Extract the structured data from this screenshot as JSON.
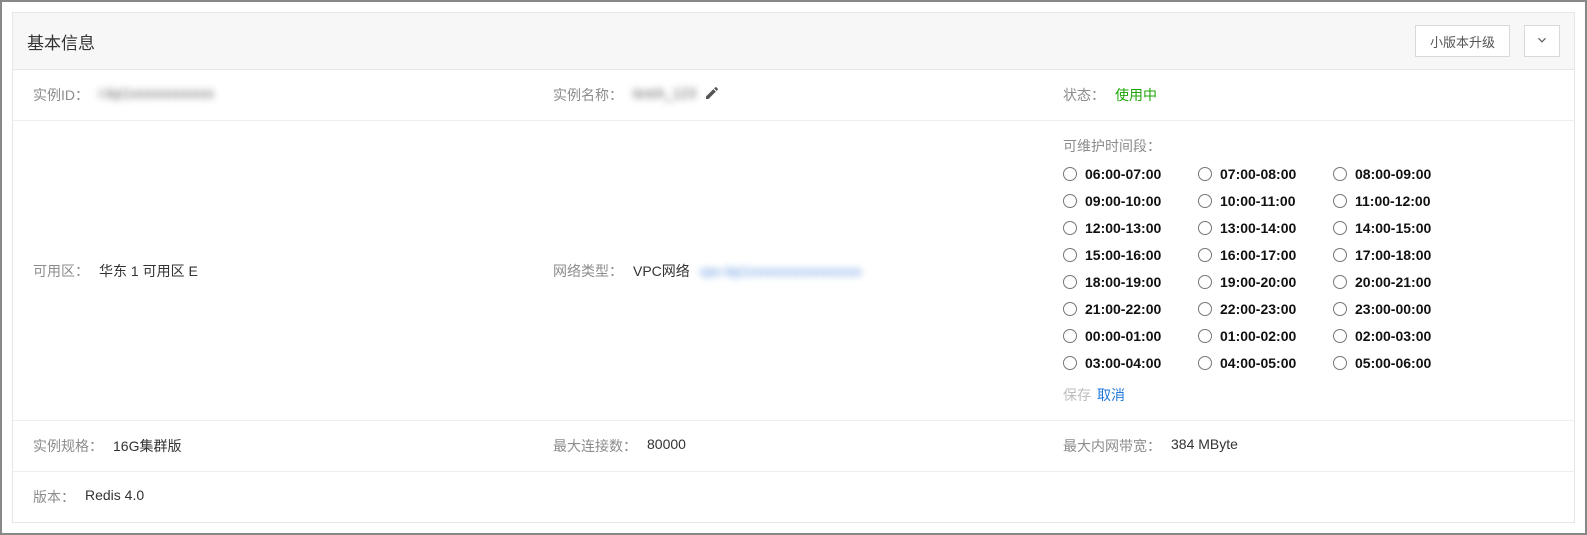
{
  "header": {
    "title": "基本信息",
    "upgrade_btn": "小版本升级"
  },
  "row1": {
    "instance_id_label": "实例ID：",
    "instance_id_value": "i-bp1xxxxxxxxxxxx",
    "instance_name_label": "实例名称：",
    "instance_name_value": "testA_123",
    "status_label": "状态：",
    "status_value": "使用中"
  },
  "row2": {
    "zone_label": "可用区：",
    "zone_value": "华东 1 可用区 E",
    "net_label": "网络类型：",
    "net_value": "VPC网络",
    "net_value_extra": "vpc-bp1xxxxxxxxxxxxxxxx",
    "maint_label": "可维护时间段：",
    "slots": [
      "06:00-07:00",
      "07:00-08:00",
      "08:00-09:00",
      "09:00-10:00",
      "10:00-11:00",
      "11:00-12:00",
      "12:00-13:00",
      "13:00-14:00",
      "14:00-15:00",
      "15:00-16:00",
      "16:00-17:00",
      "17:00-18:00",
      "18:00-19:00",
      "19:00-20:00",
      "20:00-21:00",
      "21:00-22:00",
      "22:00-23:00",
      "23:00-00:00",
      "00:00-01:00",
      "01:00-02:00",
      "02:00-03:00",
      "03:00-04:00",
      "04:00-05:00",
      "05:00-06:00"
    ],
    "save_label": "保存",
    "cancel_label": "取消"
  },
  "row3": {
    "spec_label": "实例规格：",
    "spec_value": "16G集群版",
    "maxconn_label": "最大连接数：",
    "maxconn_value": "80000",
    "bw_label": "最大内网带宽：",
    "bw_value": "384 MByte"
  },
  "row4": {
    "version_label": "版本：",
    "version_value": "Redis 4.0"
  }
}
